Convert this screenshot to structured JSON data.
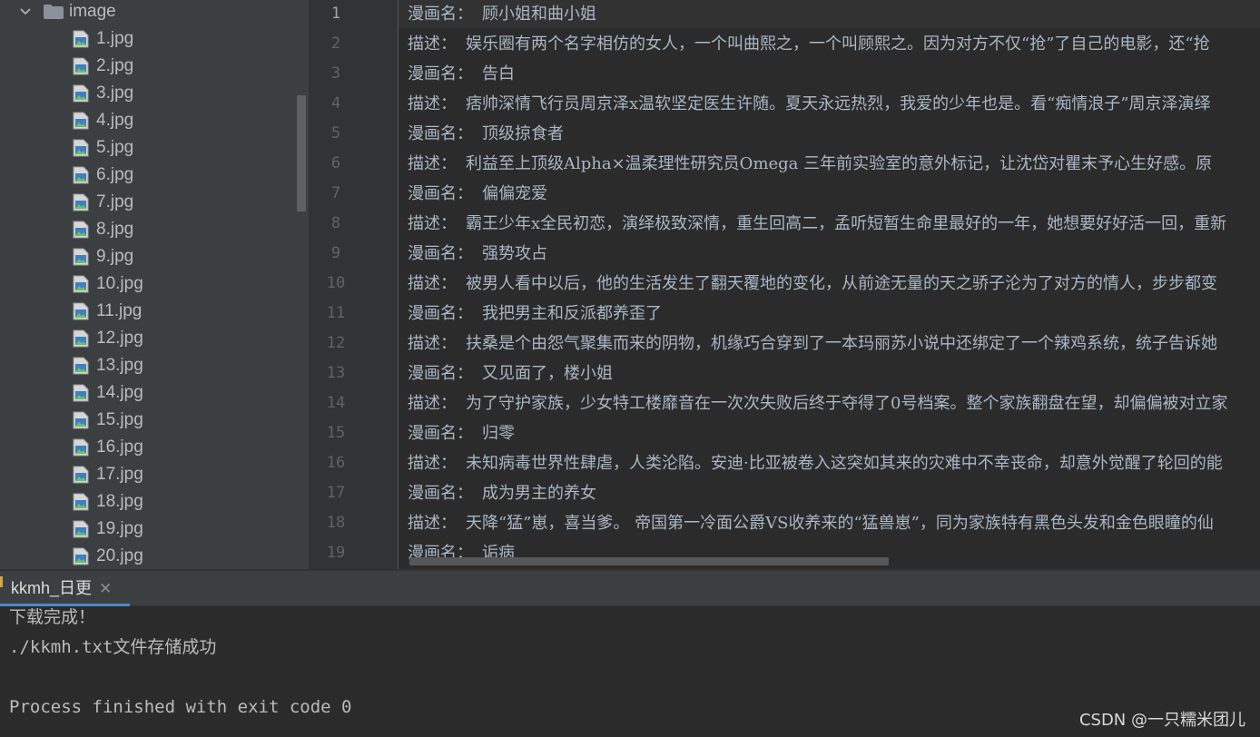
{
  "project_tree": {
    "folder": {
      "name": "image",
      "icon": "folder-icon",
      "expanded": true
    },
    "files": [
      "1.jpg",
      "2.jpg",
      "3.jpg",
      "4.jpg",
      "5.jpg",
      "6.jpg",
      "7.jpg",
      "8.jpg",
      "9.jpg",
      "10.jpg",
      "11.jpg",
      "12.jpg",
      "13.jpg",
      "14.jpg",
      "15.jpg",
      "16.jpg",
      "17.jpg",
      "18.jpg",
      "19.jpg",
      "20.jpg"
    ],
    "file_icon": "image-file-icon"
  },
  "editor": {
    "current_line": 1,
    "lines": [
      {
        "n": "1",
        "label": "漫画名：",
        "text": "顾小姐和曲小姐"
      },
      {
        "n": "2",
        "label": "描述：",
        "text": "娱乐圈有两个名字相仿的女人，一个叫曲熙之，一个叫顾熙之。因为对方不仅“抢”了自己的电影，还“抢"
      },
      {
        "n": "3",
        "label": "漫画名：",
        "text": "告白"
      },
      {
        "n": "4",
        "label": "描述：",
        "text": "痞帅深情飞行员周京泽x温软坚定医生许随。夏天永远热烈，我爱的少年也是。看“痴情浪子”周京泽演绎"
      },
      {
        "n": "5",
        "label": "漫画名：",
        "text": "顶级掠食者"
      },
      {
        "n": "6",
        "label": "描述：",
        "text": "利益至上顶级Alpha×温柔理性研究员Omega 三年前实验室的意外标记，让沈岱对瞿末予心生好感。原"
      },
      {
        "n": "7",
        "label": "漫画名：",
        "text": "偏偏宠爱"
      },
      {
        "n": "8",
        "label": "描述：",
        "text": "霸王少年x全民初恋，演绎极致深情，重生回高二，孟听短暂生命里最好的一年，她想要好好活一回，重新"
      },
      {
        "n": "9",
        "label": "漫画名：",
        "text": "强势攻占"
      },
      {
        "n": "10",
        "label": "描述：",
        "text": "被男人看中以后，他的生活发生了翻天覆地的变化，从前途无量的天之骄子沦为了对方的情人，步步都变"
      },
      {
        "n": "11",
        "label": "漫画名：",
        "text": "我把男主和反派都养歪了"
      },
      {
        "n": "12",
        "label": "描述：",
        "text": "扶桑是个由怨气聚集而来的阴物，机缘巧合穿到了一本玛丽苏小说中还绑定了一个辣鸡系统，统子告诉她"
      },
      {
        "n": "13",
        "label": "漫画名：",
        "text": "又见面了，楼小姐"
      },
      {
        "n": "14",
        "label": "描述：",
        "text": "为了守护家族，少女特工楼靡音在一次次失败后终于夺得了0号档案。整个家族翻盘在望，却偏偏被对立家"
      },
      {
        "n": "15",
        "label": "漫画名：",
        "text": "归零"
      },
      {
        "n": "16",
        "label": "描述：",
        "text": "未知病毒世界性肆虐，人类沦陷。安迪·比亚被卷入这突如其来的灾难中不幸丧命，却意外觉醒了轮回的能"
      },
      {
        "n": "17",
        "label": "漫画名：",
        "text": "成为男主的养女"
      },
      {
        "n": "18",
        "label": "描述：",
        "text": "天降“猛”崽，喜当爹。 帝国第一冷面公爵VS收养来的“猛兽崽”，同为家族特有黑色头发和金色眼瞳的仙"
      },
      {
        "n": "19",
        "label": "漫画名：",
        "text": "诟病"
      }
    ]
  },
  "run_panel": {
    "tab_label": "kkmh_日更",
    "close_icon": "close-icon",
    "console_lines": [
      "下载完成！",
      "./kkmh.txt文件存储成功",
      "",
      "Process finished with exit code 0"
    ]
  },
  "watermark": "CSDN @一只糯米团儿",
  "colors": {
    "tree_bg": "#3c3f41",
    "editor_bg": "#2b2b2b",
    "gutter_bg": "#313335",
    "text": "#a9b7c6",
    "accent": "#4a88c7"
  }
}
